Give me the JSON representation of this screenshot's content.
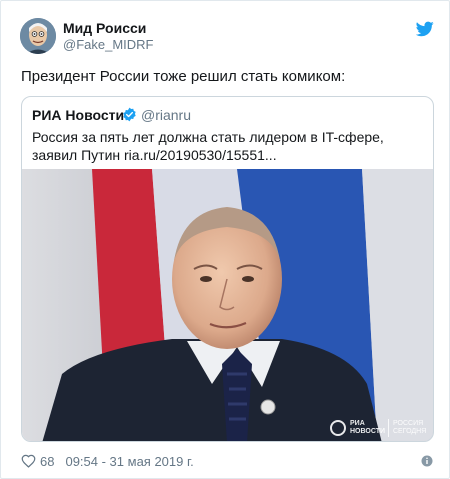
{
  "user": {
    "name": "Мид Роисси",
    "handle": "@Fake_MIDRF"
  },
  "tweet": {
    "text": "Президент России тоже решил стать комиком:"
  },
  "quoted_tweet": {
    "name": "РИА Новости",
    "handle": "@rianru",
    "text": "Россия за пять лет должна стать лидером в IT-сфере, заявил Путин ria.ru/20190530/15551...",
    "verified_icon": "verified-badge-icon",
    "image": {
      "watermark_line1": "РИА",
      "watermark_line2": "НОВОСТИ",
      "watermark_line3": "РОССИЯ",
      "watermark_line4": "СЕГОДНЯ"
    }
  },
  "footer": {
    "like_count": "68",
    "timestamp": "09:54 - 31 мая 2019 г.",
    "heart_icon": "heart-icon",
    "info_icon": "info-icon"
  },
  "colors": {
    "twitter_blue": "#1da1f2",
    "text_primary": "#14171a",
    "text_secondary": "#657786",
    "border": "#e1e8ed"
  }
}
